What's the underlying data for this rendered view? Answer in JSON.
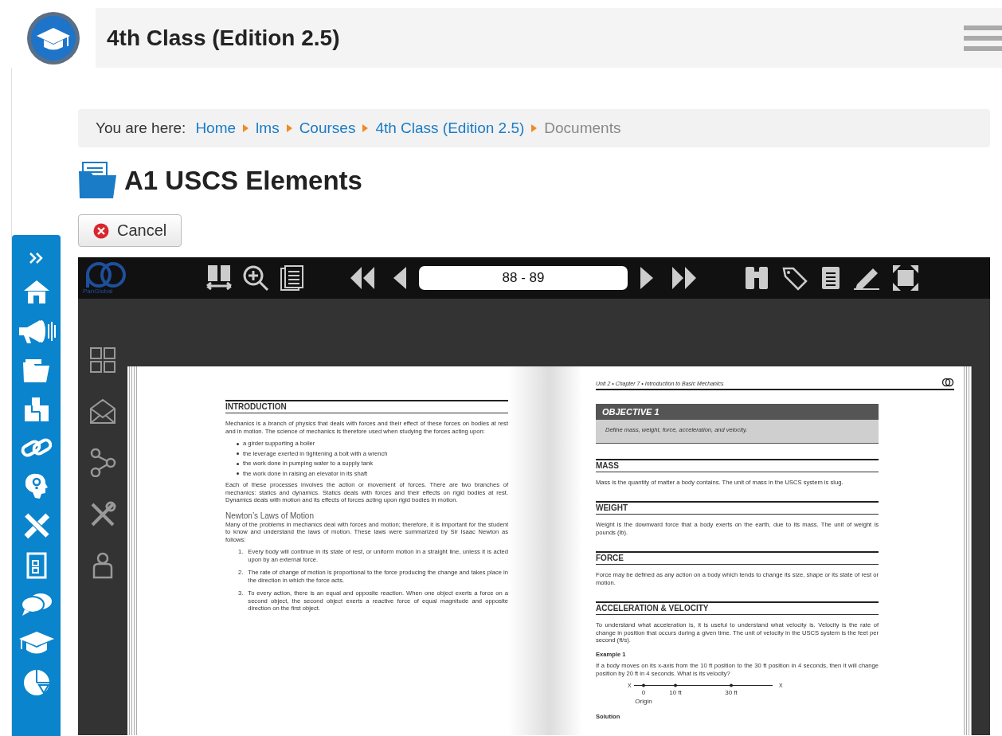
{
  "header": {
    "title": "4th Class (Edition 2.5)"
  },
  "breadcrumb": {
    "label": "You are here:",
    "items": [
      {
        "text": "Home",
        "link": true
      },
      {
        "text": "lms",
        "link": true
      },
      {
        "text": "Courses",
        "link": true
      },
      {
        "text": "4th Class (Edition 2.5)",
        "link": true
      },
      {
        "text": "Documents",
        "link": false
      }
    ]
  },
  "page_title": "A1 USCS Elements",
  "cancel_button": "Cancel",
  "viewer": {
    "logo_text": "PanGlobal",
    "page_field": "88 - 89",
    "left_page": {
      "blocks": [
        {
          "kind": "heading",
          "text": "INTRODUCTION"
        },
        {
          "kind": "paragraph",
          "text": "Mechanics is a branch of physics that deals with forces and their effect of these forces on bodies at rest and in motion. The science of mechanics is therefore used when studying the forces acting upon:"
        },
        {
          "kind": "bullets",
          "items": [
            "a girder supporting a boiler",
            "the leverage exerted in tightening a bolt with a wrench",
            "the work done in pumping water to a supply tank",
            "the work done in raising an elevator in its shaft"
          ]
        },
        {
          "kind": "paragraph",
          "text": "Each of these processes involves the action or movement of forces. There are two branches of mechanics: statics and dynamics. Statics deals with forces and their effects on rigid bodies at rest. Dynamics deals with motion and its effects of forces acting upon rigid bodies in motion."
        },
        {
          "kind": "subheading",
          "text": "Newton’s Laws of Motion"
        },
        {
          "kind": "paragraph",
          "text": "Many of the problems in mechanics deal with forces and motion; therefore, it is important for the student to know and understand the laws of motion. These laws were summarized by Sir Isaac Newton as follows:"
        },
        {
          "kind": "numbered",
          "items": [
            {
              "number": "1.",
              "text": "Every body will continue in its state of rest, or uniform motion in a straight line, unless it is acted upon by an external force."
            },
            {
              "number": "2.",
              "text": "The rate of change of motion is proportional to the force producing the change and takes place in the direction in which the force acts."
            },
            {
              "number": "3.",
              "text": "To every action, there is an equal and opposite reaction. When one object exerts a force on a second object, the second object exerts a reactive force of equal magnitude and opposite direction on the first object."
            }
          ]
        }
      ]
    },
    "right_page": {
      "running_head": "Unit 2 • Chapter 7 • Introduction to Basic Mechanics",
      "objective": {
        "title": "OBJECTIVE 1",
        "text": "Define mass, weight, force, acceleration, and velocity."
      },
      "blocks": [
        {
          "kind": "heading",
          "text": "MASS"
        },
        {
          "kind": "paragraph",
          "text": "Mass is the quantity of matter a body contains. The unit of mass in the USCS system is slug."
        },
        {
          "kind": "heading",
          "text": "WEIGHT"
        },
        {
          "kind": "paragraph",
          "text": "Weight is the downward force that a body exerts on the earth, due to its mass. The unit of weight is pounds (lb)."
        },
        {
          "kind": "heading",
          "text": "FORCE"
        },
        {
          "kind": "paragraph",
          "text": "Force may be defined as any action on a body which tends to change its size, shape or its state of rest or motion."
        },
        {
          "kind": "heading",
          "text": "ACCELERATION & VELOCITY"
        },
        {
          "kind": "paragraph",
          "text": "To understand what acceleration is, it is useful to understand what velocity is. Velocity is the rate of change in position that occurs during a given time. The unit of velocity in the USCS system is the feet per second (ft/s)."
        },
        {
          "kind": "bold",
          "text": "Example 1"
        },
        {
          "kind": "paragraph",
          "text": "If a body moves on its x-axis from the 10 ft position to the 30 ft position in 4 seconds, then it will change position by 20 ft in 4 seconds. What is its velocity?"
        },
        {
          "kind": "numberline",
          "axis_labels": [
            "X",
            "X"
          ],
          "ticks": [
            "0",
            "10 ft",
            "30 ft"
          ],
          "origin_label": "Origin"
        },
        {
          "kind": "bold",
          "text": "Solution"
        }
      ]
    }
  }
}
